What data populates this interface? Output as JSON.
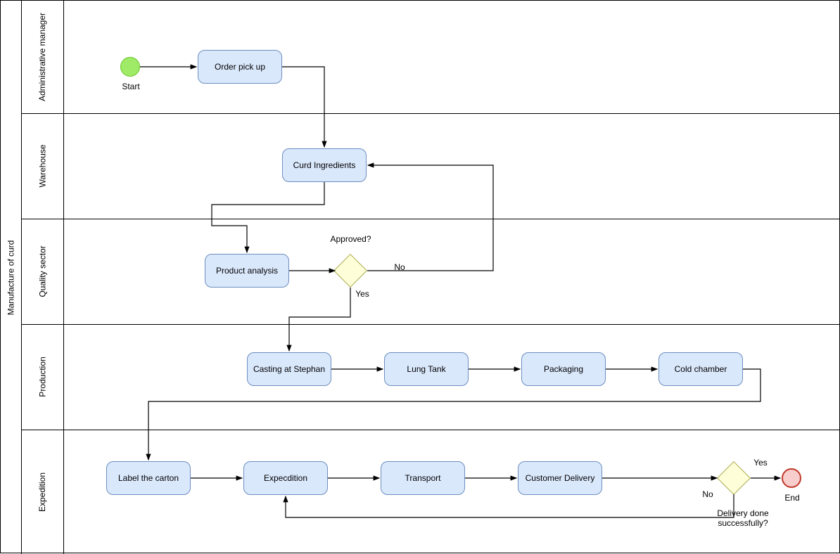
{
  "pool": "Manufacture of curd",
  "lanes": {
    "l1": "Administrative manager",
    "l2": "Warehouse",
    "l3": "Quality sector",
    "l4": "Production",
    "l5": "Expedition"
  },
  "labels": {
    "start": "Start",
    "end": "End",
    "approved": "Approved?",
    "yes": "Yes",
    "no": "No",
    "deliverySuccess": "Delivery done\nsuccessfully?"
  },
  "tasks": {
    "orderPickUp": "Order pick up",
    "curdIngredients": "Curd Ingredients",
    "productAnalysis": "Product analysis",
    "casting": "Casting at Stephan",
    "lungTank": "Lung Tank",
    "packaging": "Packaging",
    "coldChamber": "Cold chamber",
    "labelCarton": "Label the carton",
    "expedition": "Expecdition",
    "transport": "Transport",
    "customerDelivery": "Customer Delivery"
  }
}
